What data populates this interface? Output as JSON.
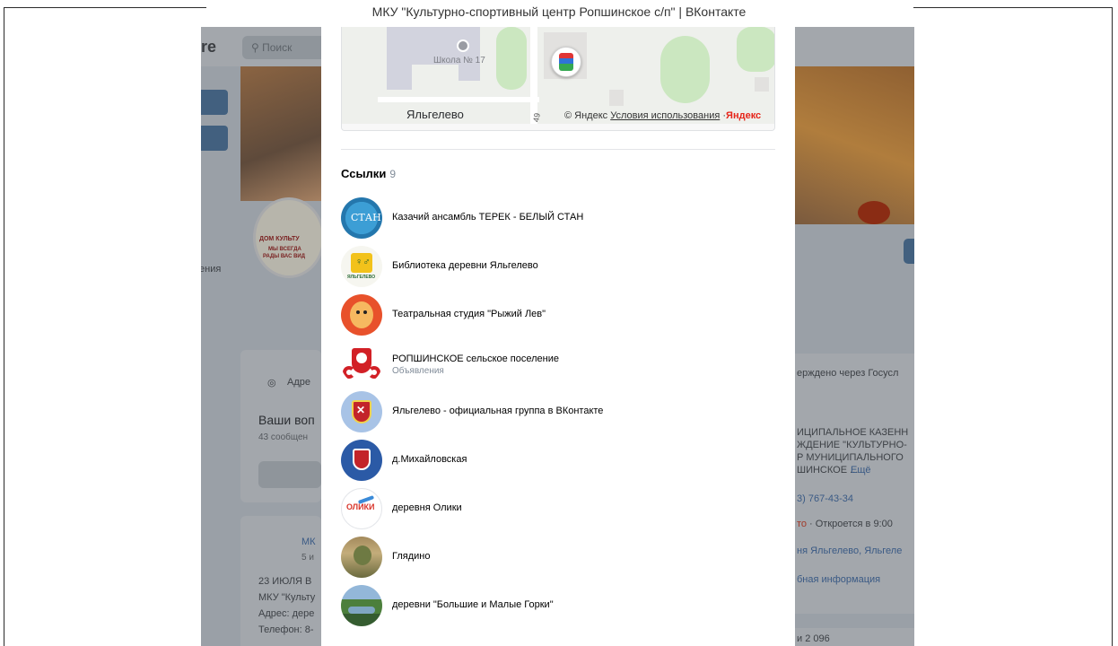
{
  "window": {
    "title": "МКУ \"Культурно-спортивный центр Ропшинское с/п\" | ВКонтакте"
  },
  "background": {
    "logo_fragment": "re",
    "search_placeholder": "Поиск",
    "left_fragment": "ения",
    "address_label": "Адре",
    "questions_title": "Ваши воп",
    "questions_count": "43 сообщен",
    "post_author_fragment": "МК",
    "post_time_fragment": "5 и",
    "post_line1": "23 ИЮЛЯ В",
    "post_line2": "МКУ \"Культу",
    "post_line3": "Адрес: дере",
    "post_line4": "Телефон: 8-",
    "avatar_text1": "ДОМ КУЛЬТУ",
    "avatar_text2": "МЫ ВСЕГДА",
    "avatar_text3": "РАДЫ ВАС ВИД",
    "right_gosuslugi": "ерждено через Госусл",
    "right_org1": "ИЦИПАЛЬНОЕ КАЗЕНН",
    "right_org2": "ЖДЕНИЕ \"КУЛЬТУРНО-",
    "right_org3": "Р МУНИЦИПАЛЬНОГО",
    "right_org4": "ШИНСКОЕ ...",
    "right_more": "Ещё",
    "right_phone": "3) 767-43-34",
    "right_status_closed": "то",
    "right_status_open": "· Откроется в 9:00",
    "right_address": "ня Яльгелево, Яльгеле",
    "right_more_info": "бная информация",
    "right_bottom": "и 2 096"
  },
  "map": {
    "school_label": "Школа № 17",
    "village_label": "Яльгелево",
    "road_number": "49",
    "attribution_prefix": "© Яндекс",
    "terms_link": "Условия использования",
    "brand_dot": "·",
    "brand": "Яндекс"
  },
  "links": {
    "title": "Ссылки",
    "count": "9",
    "items": [
      {
        "name": "Казачий ансамбль ТЕРЕК - БЕЛЫЙ СТАН",
        "desc": "",
        "icon": "terek-logo-icon"
      },
      {
        "name": "Библиотека деревни Яльгелево",
        "desc": "",
        "icon": "library-logo-icon"
      },
      {
        "name": "Театральная студия \"Рыжий Лев\"",
        "desc": "",
        "icon": "lion-logo-icon"
      },
      {
        "name": "РОПШИНСКОЕ сельское поселение",
        "desc": "Объявления",
        "icon": "ropsha-coat-of-arms-icon"
      },
      {
        "name": "Яльгелево - официальная группа в ВКонтакте",
        "desc": "",
        "icon": "yalgelevo-coat-of-arms-icon"
      },
      {
        "name": "д.Михайловская",
        "desc": "",
        "icon": "mikhailovskaya-coat-of-arms-icon"
      },
      {
        "name": "деревня Олики",
        "desc": "",
        "icon": "oliki-logo-icon"
      },
      {
        "name": "Глядино",
        "desc": "",
        "icon": "glyadino-photo-icon"
      },
      {
        "name": "деревни \"Большие и Малые Горки\"",
        "desc": "",
        "icon": "gorki-photo-icon"
      }
    ]
  },
  "colors": {
    "overlay": "#9aa0a7",
    "link_text": "#000000",
    "secondary_text": "#818c99",
    "yandex_red": "#e6251a"
  }
}
